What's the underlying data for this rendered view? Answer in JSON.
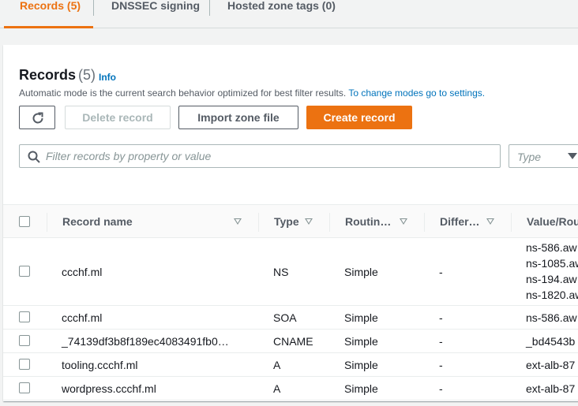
{
  "tabs": [
    {
      "label": "Records (5)",
      "active": true
    },
    {
      "label": "DNSSEC signing",
      "active": false
    },
    {
      "label": "Hosted zone tags (0)",
      "active": false
    }
  ],
  "panel": {
    "title": "Records",
    "count": "(5)",
    "info": "Info",
    "description": "Automatic mode is the current search behavior optimized for best filter results.",
    "description_link": "To change modes go to settings."
  },
  "toolbar": {
    "delete_label": "Delete record",
    "import_label": "Import zone file",
    "create_label": "Create record"
  },
  "search": {
    "placeholder": "Filter records by property or value"
  },
  "type_filter": {
    "placeholder": "Type"
  },
  "columns": [
    "Record name",
    "Type",
    "Routin…",
    "Differ…",
    "Value/Rou"
  ],
  "records": [
    {
      "name": "ccchf.ml",
      "type": "NS",
      "routing": "Simple",
      "differ": "-",
      "values": [
        "ns-586.aw",
        "ns-1085.aw",
        "ns-194.aw",
        "ns-1820.aw"
      ]
    },
    {
      "name": "ccchf.ml",
      "type": "SOA",
      "routing": "Simple",
      "differ": "-",
      "values": [
        "ns-586.aw"
      ]
    },
    {
      "name": "_74139df3b8f189ec4083491fb0…",
      "type": "CNAME",
      "routing": "Simple",
      "differ": "-",
      "values": [
        "_bd4543b"
      ]
    },
    {
      "name": "tooling.ccchf.ml",
      "type": "A",
      "routing": "Simple",
      "differ": "-",
      "values": [
        "ext-alb-87"
      ]
    },
    {
      "name": "wordpress.ccchf.ml",
      "type": "A",
      "routing": "Simple",
      "differ": "-",
      "values": [
        "ext-alb-87"
      ]
    }
  ],
  "colors": {
    "accent": "#ec7211",
    "link": "#0073bb"
  }
}
